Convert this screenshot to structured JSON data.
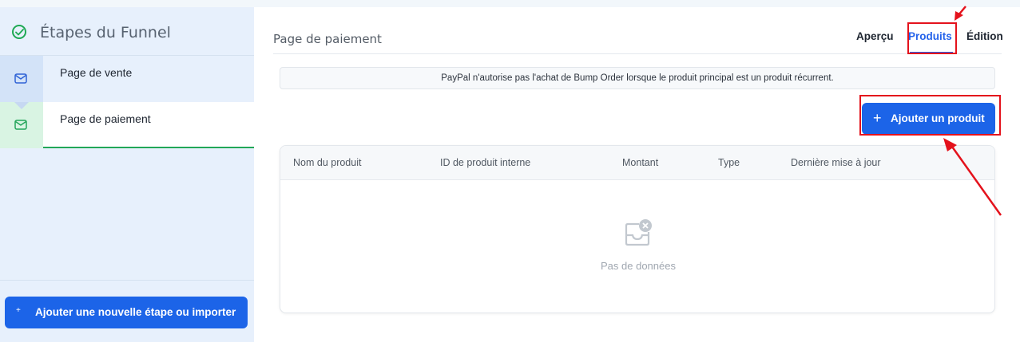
{
  "sidebar": {
    "title": "Étapes du Funnel",
    "steps": [
      {
        "label": "Page de vente",
        "icon": "mail-icon"
      },
      {
        "label": "Page de paiement",
        "icon": "mail-icon"
      }
    ],
    "add_step_label": "Ajouter une nouvelle étape ou importer",
    "add_step_icon": "+"
  },
  "main": {
    "page_title": "Page de paiement",
    "tabs": [
      {
        "label": "Aperçu"
      },
      {
        "label": "Produits",
        "active": true
      },
      {
        "label": "Édition"
      }
    ],
    "notice": "PayPal n'autorise pas l'achat de Bump Order lorsque le produit principal est un produit récurrent.",
    "add_product_label": "Ajouter un produit",
    "add_product_icon": "+",
    "table": {
      "columns": [
        "Nom du produit",
        "ID de produit interne",
        "Montant",
        "Type",
        "Dernière mise à jour"
      ],
      "rows": [],
      "empty_text": "Pas de données"
    }
  },
  "colors": {
    "accent": "#2563eb",
    "button": "#1c64e8",
    "success": "#21a758",
    "annotation": "#e4121c"
  }
}
